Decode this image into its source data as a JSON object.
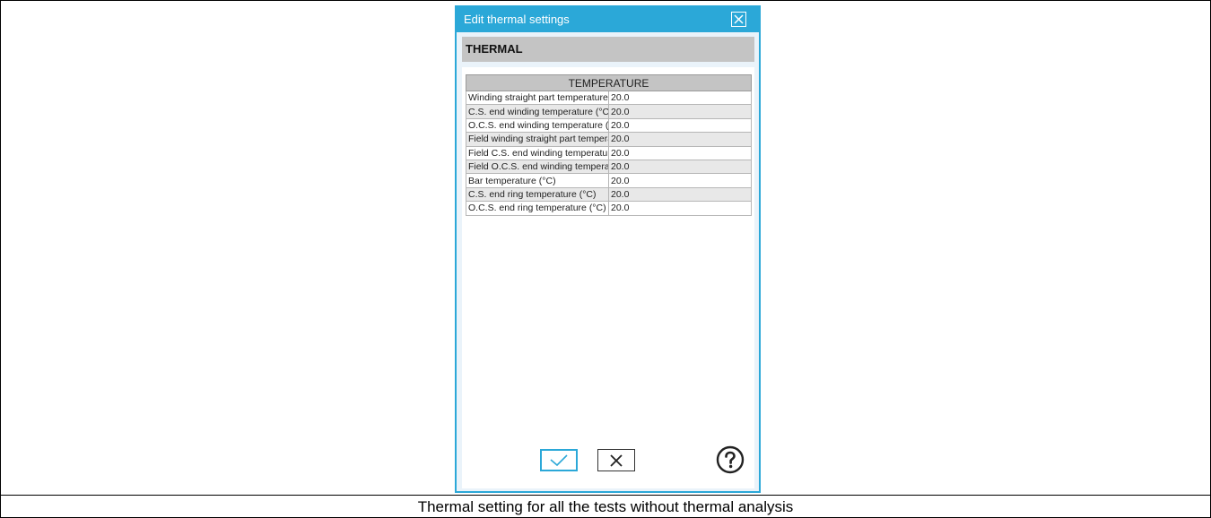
{
  "dialog": {
    "title": "Edit thermal settings",
    "section_header": "THERMAL",
    "table": {
      "header": "TEMPERATURE",
      "rows": [
        {
          "label": "Winding straight part temperature (°C)",
          "value": "20.0"
        },
        {
          "label": "C.S. end winding temperature (°C)",
          "value": "20.0"
        },
        {
          "label": "O.C.S. end winding temperature (°C)",
          "value": "20.0"
        },
        {
          "label": "Field winding straight part temperature (°C)",
          "value": "20.0"
        },
        {
          "label": "Field C.S. end winding temperature (°C)",
          "value": "20.0"
        },
        {
          "label": "Field O.C.S. end winding temperature (°C)",
          "value": "20.0"
        },
        {
          "label": "Bar temperature (°C)",
          "value": "20.0"
        },
        {
          "label": "C.S. end ring temperature (°C)",
          "value": "20.0"
        },
        {
          "label": "O.C.S. end ring temperature (°C)",
          "value": "20.0"
        }
      ]
    },
    "icons": {
      "close": "close-icon",
      "ok": "checkmark-icon",
      "cancel": "x-icon",
      "help": "help-icon"
    },
    "colors": {
      "accent": "#2ba8d8",
      "section_bg": "#c4c4c4"
    }
  },
  "caption": "Thermal setting for all the tests without thermal analysis"
}
